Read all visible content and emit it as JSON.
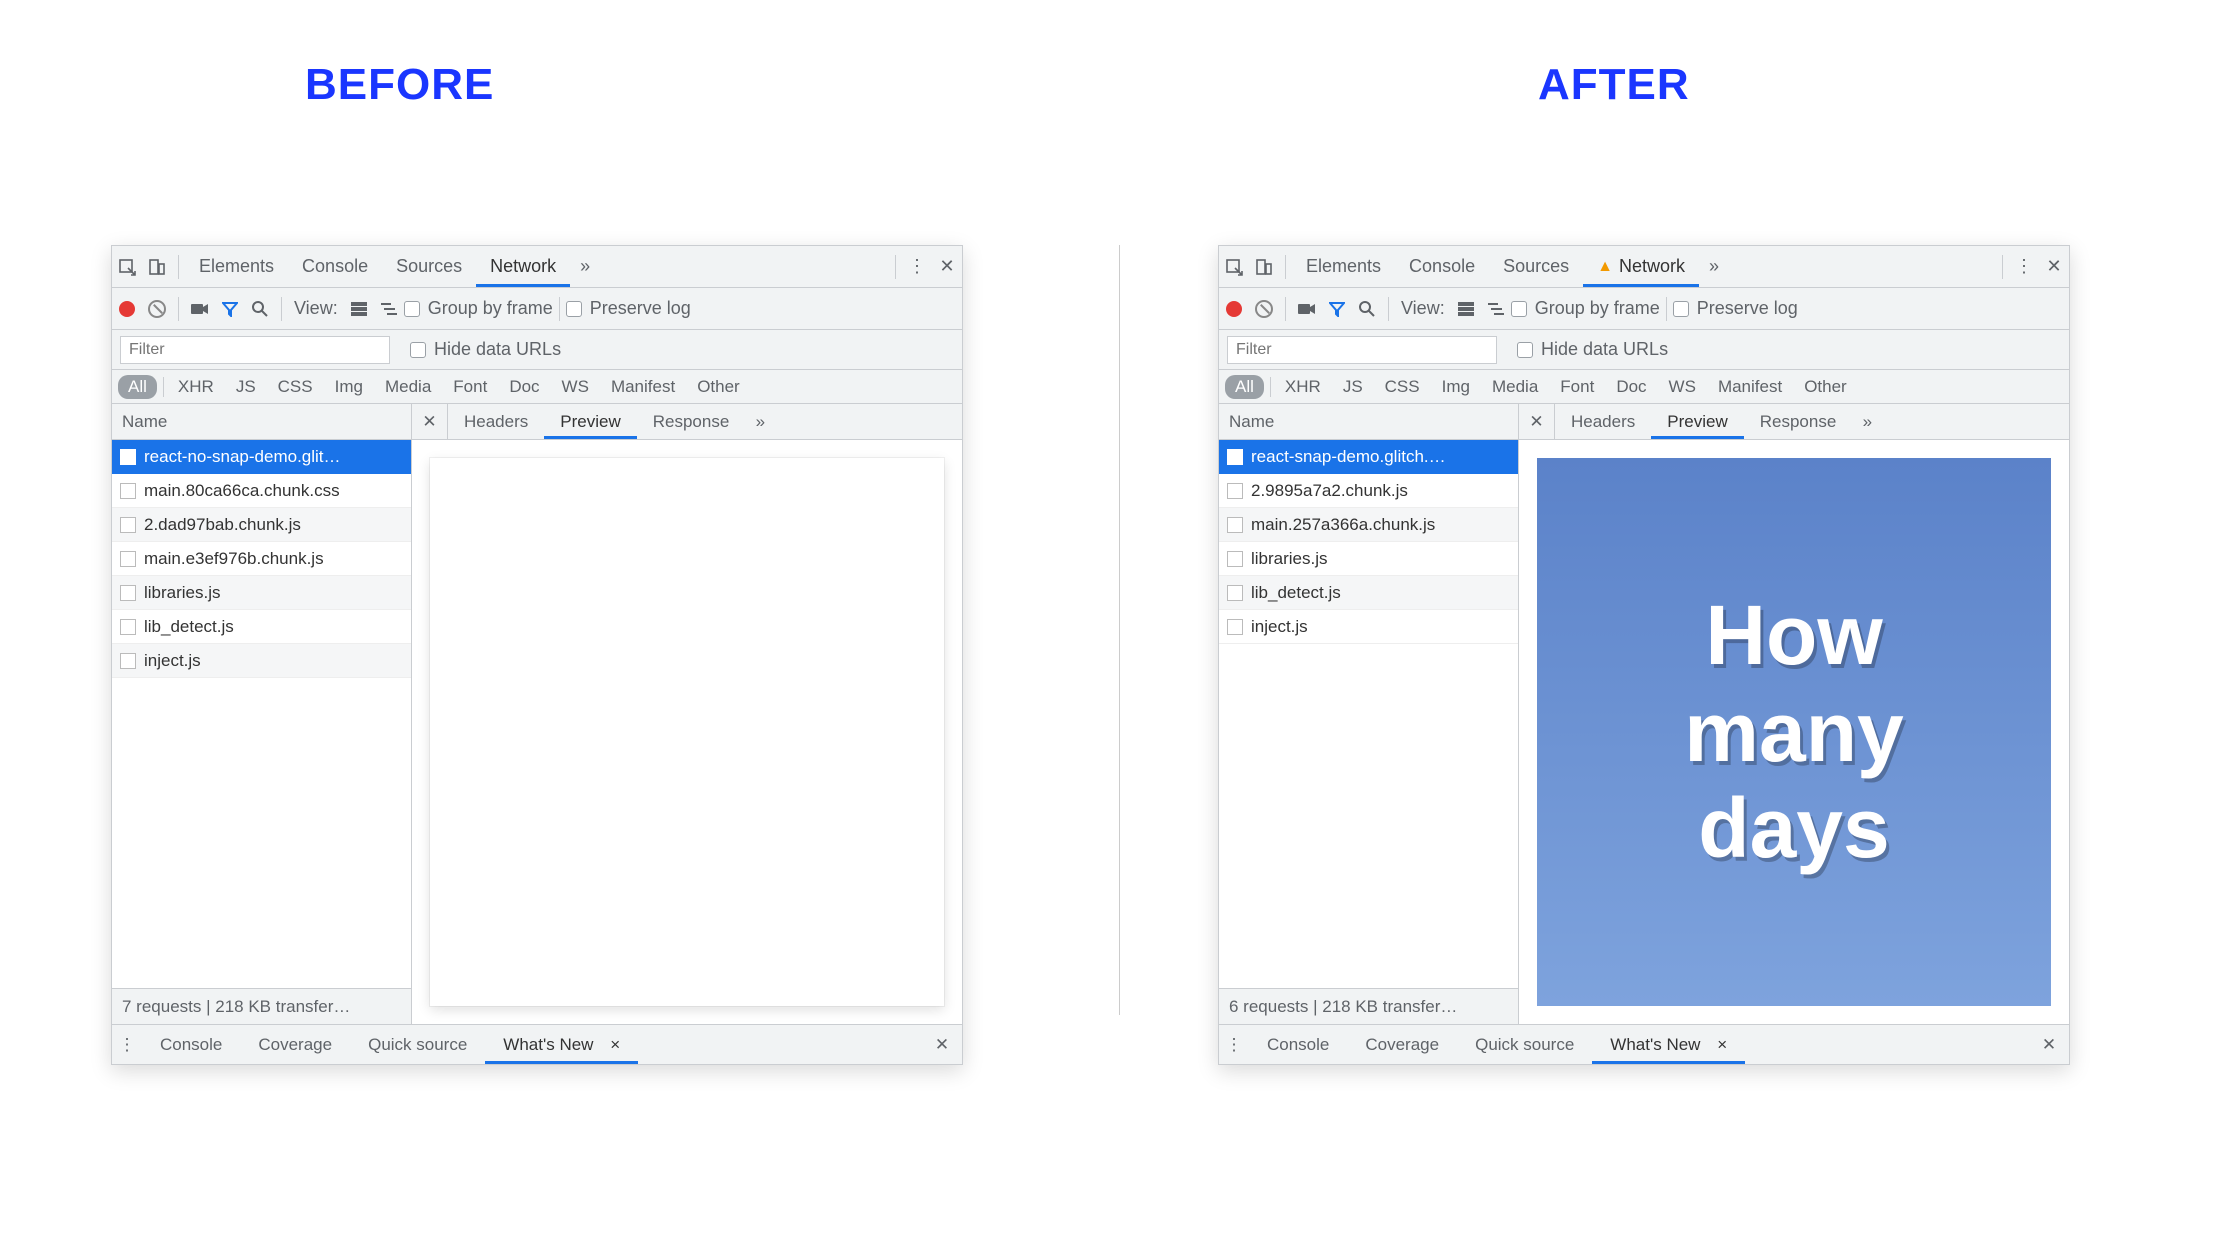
{
  "labels": {
    "before": "BEFORE",
    "after": "AFTER"
  },
  "main_tabs": {
    "elements": "Elements",
    "console": "Console",
    "sources": "Sources",
    "network": "Network"
  },
  "toolbar": {
    "view": "View:",
    "group_by_frame": "Group by frame",
    "preserve_log": "Preserve log"
  },
  "filter": {
    "placeholder": "Filter",
    "hide_data_urls": "Hide data URLs"
  },
  "types": {
    "all": "All",
    "xhr": "XHR",
    "js": "JS",
    "css": "CSS",
    "img": "Img",
    "media": "Media",
    "font": "Font",
    "doc": "Doc",
    "ws": "WS",
    "manifest": "Manifest",
    "other": "Other"
  },
  "cols": {
    "name": "Name"
  },
  "detail_tabs": {
    "headers": "Headers",
    "preview": "Preview",
    "response": "Response"
  },
  "drawer": {
    "console": "Console",
    "coverage": "Coverage",
    "quick_source": "Quick source",
    "whats_new": "What's New"
  },
  "before": {
    "network_has_warning": false,
    "requests": [
      "react-no-snap-demo.glit…",
      "main.80ca66ca.chunk.css",
      "2.dad97bab.chunk.js",
      "main.e3ef976b.chunk.js",
      "libraries.js",
      "lib_detect.js",
      "inject.js"
    ],
    "status": "7 requests | 218 KB transfer…",
    "preview_text": ""
  },
  "after": {
    "network_has_warning": true,
    "requests": [
      "react-snap-demo.glitch.…",
      "2.9895a7a2.chunk.js",
      "main.257a366a.chunk.js",
      "libraries.js",
      "lib_detect.js",
      "inject.js"
    ],
    "status": "6 requests | 218 KB transfer…",
    "preview_text": "How\nmany\ndays"
  }
}
